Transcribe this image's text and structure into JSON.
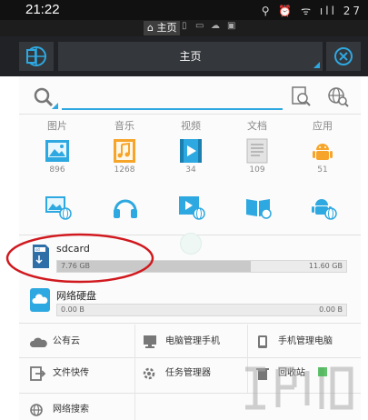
{
  "status_bar": {
    "time": "21:22",
    "icons_text": "⚲ ⏰ ᯤ ıll 27"
  },
  "tab_strip": {
    "active_tab": "主页"
  },
  "title_bar": {
    "title": "主页"
  },
  "categories": [
    {
      "label": "图片",
      "count": "896",
      "icon": "image-icon"
    },
    {
      "label": "音乐",
      "count": "1268",
      "icon": "music-icon"
    },
    {
      "label": "视频",
      "count": "34",
      "icon": "video-icon"
    },
    {
      "label": "文档",
      "count": "109",
      "icon": "document-icon"
    },
    {
      "label": "应用",
      "count": "51",
      "icon": "android-icon"
    }
  ],
  "storage": {
    "name": "sdcard",
    "used": "7.76 GB",
    "total": "11.60 GB",
    "used_fraction": 0.669
  },
  "cloud_storage": {
    "name": "网络硬盘",
    "used": "0.00 B",
    "total": "0.00 B"
  },
  "tools": [
    {
      "label": "公有云",
      "icon": "cloud-icon"
    },
    {
      "label": "电脑管理手机",
      "icon": "pc-manage-phone-icon"
    },
    {
      "label": "手机管理电脑",
      "icon": "phone-manage-pc-icon"
    },
    {
      "label": "文件快传",
      "icon": "file-transfer-icon"
    },
    {
      "label": "任务管理器",
      "icon": "task-manager-icon"
    },
    {
      "label": "回收站",
      "icon": "recycle-bin-icon"
    },
    {
      "label": "网络搜索",
      "icon": "web-search-icon"
    }
  ],
  "colors": {
    "accent": "#2ea8e0",
    "titlebar": "#202226",
    "highlight_ring": "#d0191e"
  }
}
